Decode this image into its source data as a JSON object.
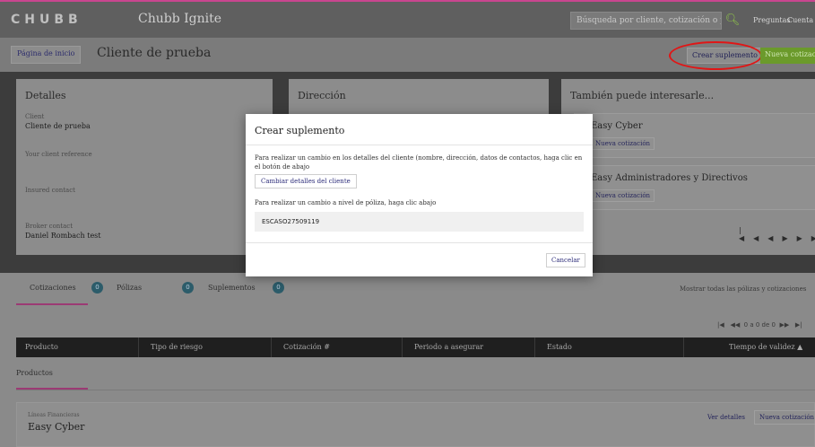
{
  "header": {
    "logo": "CHUBB",
    "app_title": "Chubb Ignite",
    "search_placeholder": "Búsqueda por cliente, cotización o póliza",
    "links": [
      "Preguntas",
      "Cuenta"
    ]
  },
  "subheader": {
    "home_label": "Página de inicio",
    "client_title": "Cliente de prueba",
    "create_supplement_label": "Crear suplemento",
    "new_quote_label": "Nueva cotización"
  },
  "details_card": {
    "title": "Detalles",
    "client_label": "Client",
    "client_value": "Cliente de prueba",
    "reference_label": "Your client reference",
    "insured_label": "Insured contact",
    "broker_label": "Broker contact",
    "broker_value": "Daniel Rombach test"
  },
  "address_card": {
    "title": "Dirección"
  },
  "interest_card": {
    "title": "También puede interesarle...",
    "promos": [
      {
        "name": "Easy Cyber",
        "button": "Nueva cotización"
      },
      {
        "name": "Easy Administradores y Directivos",
        "button": "Nueva cotización"
      }
    ]
  },
  "tabs": {
    "quotes_label": "Cotizaciones",
    "quotes_count": "0",
    "policies_label": "Pólizas",
    "policies_count": "0",
    "supplements_label": "Suplementos",
    "supplements_count": "0",
    "show_all": "Mostrar todas las pólizas y cotizaciones"
  },
  "table": {
    "pager_text": "0 a 0 de 0",
    "columns": [
      "Producto",
      "Tipo de riesgo",
      "Cotización #",
      "Periodo a asegurar",
      "Estado",
      "Tiempo de validez ▲"
    ]
  },
  "products_section": {
    "tab_label": "Productos",
    "category": "Líneas Financieras",
    "product_name": "Easy Cyber",
    "details_link": "Ver detalles",
    "new_quote_button": "Nueva cotización"
  },
  "modal": {
    "title": "Crear suplemento",
    "client_change_text": "Para realizar un cambio en los detalles del cliente (nombre, dirección, datos de contactos, haga clic en el botón de abajo",
    "change_client_button": "Cambiar detalles del cliente",
    "policy_change_text": "Para realizar un cambio a nivel de póliza, haga clic abajo",
    "policy_number": "ESCASO27509119",
    "cancel_button": "Cancelar"
  }
}
